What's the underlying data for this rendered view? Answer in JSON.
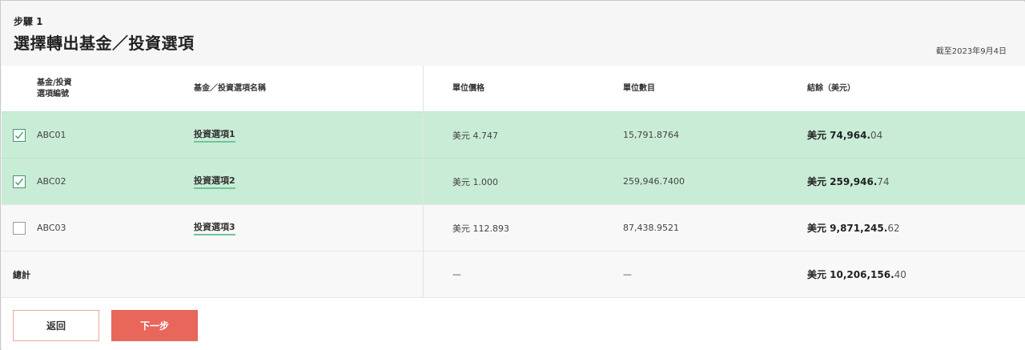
{
  "header": {
    "step": "步驟 1",
    "title": "選擇轉出基金／投資選項",
    "as_of": "截至2023年9月4日"
  },
  "table": {
    "columns": {
      "code": [
        "基金/投資",
        "選項編號"
      ],
      "name": "基金／投資選項名稱",
      "unit_price": "單位價格",
      "units": "單位數目",
      "balance": "結餘（美元）"
    },
    "rows": [
      {
        "checked": true,
        "code": "ABC01",
        "name": "投資選項1",
        "unit_price": "美元 4.747",
        "units": "15,791.8764",
        "balance_main": "美元 74,964.",
        "balance_cents": "04"
      },
      {
        "checked": true,
        "code": "ABC02",
        "name": "投資選項2",
        "unit_price": "美元 1.000",
        "units": "259,946.7400",
        "balance_main": "美元 259,946.",
        "balance_cents": "74"
      },
      {
        "checked": false,
        "code": "ABC03",
        "name": "投資選項3",
        "unit_price": "美元 112.893",
        "units": "87,438.9521",
        "balance_main": "美元 9,871,245.",
        "balance_cents": "62"
      }
    ],
    "total": {
      "label": "總計",
      "unit_price": "—",
      "units": "—",
      "balance_main": "美元 10,206,156.",
      "balance_cents": "40"
    }
  },
  "actions": {
    "back_label": "返回",
    "next_label": "下一步"
  },
  "colors": {
    "selected_row": "#c9ecd7",
    "link_underline": "#6cc797",
    "primary_button": "#e8665a",
    "secondary_button_border": "#e9a99b"
  }
}
